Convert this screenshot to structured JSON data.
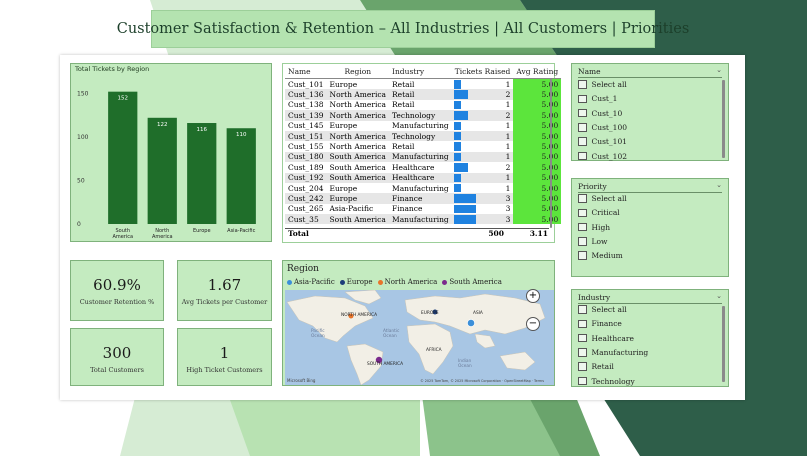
{
  "header": {
    "title": "Customer Satisfaction & Retention – All Industries | All Customers | Priorities"
  },
  "bar_chart": {
    "title": "Total Tickets by Region",
    "y_ticks": [
      "150",
      "100",
      "50",
      "0"
    ]
  },
  "chart_data": {
    "type": "bar",
    "title": "Total Tickets by Region",
    "categories": [
      "South America",
      "North America",
      "Europe",
      "Asia-Pacific"
    ],
    "category_lines": [
      [
        "South",
        "America"
      ],
      [
        "North",
        "America"
      ],
      [
        "Europe"
      ],
      [
        "Asia-Pacific"
      ]
    ],
    "values": [
      152,
      122,
      116,
      110
    ],
    "ylim": [
      0,
      170
    ],
    "y_ticks": [
      0,
      50,
      100,
      150
    ],
    "bar_color": "#1f6e2a",
    "xlabel": "",
    "ylabel": ""
  },
  "kpis": [
    {
      "value": "60.9%",
      "label": "Customer Retention %"
    },
    {
      "value": "1.67",
      "label": "Avg Tickets per Customer"
    },
    {
      "value": "300",
      "label": "Total Customers"
    },
    {
      "value": "1",
      "label": "High Ticket Customers"
    }
  ],
  "table": {
    "columns": [
      "Name",
      "Region",
      "Industry",
      "Tickets Raised",
      "Avg Rating"
    ],
    "rows": [
      {
        "name": "Cust_101",
        "region": "Europe",
        "industry": "Retail",
        "tickets": 1,
        "rating": "5.00"
      },
      {
        "name": "Cust_136",
        "region": "North America",
        "industry": "Retail",
        "tickets": 2,
        "rating": "5.00"
      },
      {
        "name": "Cust_138",
        "region": "North America",
        "industry": "Retail",
        "tickets": 1,
        "rating": "5.00"
      },
      {
        "name": "Cust_139",
        "region": "North America",
        "industry": "Technology",
        "tickets": 2,
        "rating": "5.00"
      },
      {
        "name": "Cust_145",
        "region": "Europe",
        "industry": "Manufacturing",
        "tickets": 1,
        "rating": "5.00"
      },
      {
        "name": "Cust_151",
        "region": "North America",
        "industry": "Technology",
        "tickets": 1,
        "rating": "5.00"
      },
      {
        "name": "Cust_155",
        "region": "North America",
        "industry": "Retail",
        "tickets": 1,
        "rating": "5.00"
      },
      {
        "name": "Cust_180",
        "region": "South America",
        "industry": "Manufacturing",
        "tickets": 1,
        "rating": "5.00"
      },
      {
        "name": "Cust_189",
        "region": "South America",
        "industry": "Healthcare",
        "tickets": 2,
        "rating": "5.00"
      },
      {
        "name": "Cust_192",
        "region": "South America",
        "industry": "Healthcare",
        "tickets": 1,
        "rating": "5.00"
      },
      {
        "name": "Cust_204",
        "region": "Europe",
        "industry": "Manufacturing",
        "tickets": 1,
        "rating": "5.00"
      },
      {
        "name": "Cust_242",
        "region": "Europe",
        "industry": "Finance",
        "tickets": 3,
        "rating": "5.00"
      },
      {
        "name": "Cust_265",
        "region": "Asia-Pacific",
        "industry": "Finance",
        "tickets": 3,
        "rating": "5.00"
      },
      {
        "name": "Cust_35",
        "region": "South America",
        "industry": "Manufacturing",
        "tickets": 3,
        "rating": "5.00"
      }
    ],
    "total": {
      "label": "Total",
      "tickets": "500",
      "rating": "3.11"
    },
    "colors": {
      "bar": "#1f82e0",
      "rating": "#5ce53c"
    }
  },
  "map": {
    "title": "Region",
    "legend": [
      {
        "name": "Asia-Pacific",
        "color": "#3b8fd9"
      },
      {
        "name": "Europe",
        "color": "#1c3d7a"
      },
      {
        "name": "North America",
        "color": "#e8742a"
      },
      {
        "name": "South America",
        "color": "#7a2a8c"
      }
    ],
    "labels": {
      "north_america": "NORTH AMERICA",
      "europe": "EUROPE",
      "asia": "ASIA",
      "africa": "AFRICA",
      "south_america": "SOUTH AMERICA",
      "pacific": "Pacific\nOcean",
      "atlantic": "Atlantic\nOcean",
      "indian": "Indian\nOcean"
    },
    "zoom_in": "+",
    "zoom_out": "−",
    "bing": "Microsoft Bing",
    "copyright": "© 2025 TomTom, © 2025 Microsoft Corporation · OpenStreetMap · Terms"
  },
  "slicers": {
    "name": {
      "title": "Name",
      "options": [
        "Select all",
        "Cust_1",
        "Cust_10",
        "Cust_100",
        "Cust_101",
        "Cust_102"
      ]
    },
    "priority": {
      "title": "Priority",
      "options": [
        "Select all",
        "Critical",
        "High",
        "Low",
        "Medium"
      ]
    },
    "industry": {
      "title": "Industry",
      "options": [
        "Select all",
        "Finance",
        "Healthcare",
        "Manufacturing",
        "Retail",
        "Technology"
      ]
    }
  }
}
